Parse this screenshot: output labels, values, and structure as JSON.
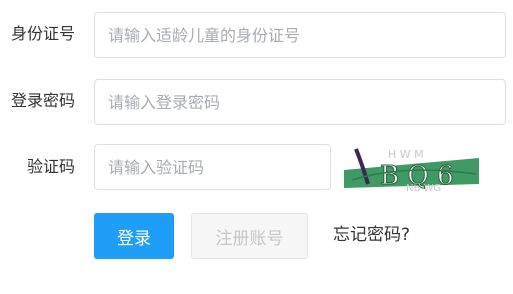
{
  "form": {
    "id_label": "身份证号",
    "id_placeholder": "请输入适龄儿童的身份证号",
    "password_label": "登录密码",
    "password_placeholder": "请输入登录密码",
    "captcha_label": "验证码",
    "captcha_placeholder": "请输入验证码",
    "captcha_image_text": "B Q 6"
  },
  "actions": {
    "login_label": "登录",
    "register_label": "注册账号",
    "forgot_label": "忘记密码?"
  },
  "colors": {
    "primary": "#1e9ef6",
    "captcha_background": "#3f9a66"
  }
}
